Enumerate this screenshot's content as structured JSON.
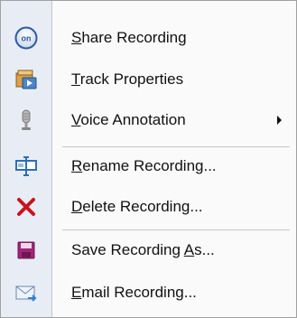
{
  "menu": {
    "items": [
      {
        "icon": "share-icon",
        "pre": "",
        "acc": "S",
        "post": "hare Recording"
      },
      {
        "icon": "track-properties-icon",
        "pre": "",
        "acc": "T",
        "post": "rack Properties"
      },
      {
        "icon": "microphone-icon",
        "pre": "",
        "acc": "V",
        "post": "oice Annotation",
        "submenu": true
      },
      {
        "icon": "rename-icon",
        "pre": "",
        "acc": "R",
        "post": "ename Recording..."
      },
      {
        "icon": "delete-icon",
        "pre": "",
        "acc": "D",
        "post": "elete Recording..."
      },
      {
        "icon": "save-icon",
        "pre": "Save Recording ",
        "acc": "A",
        "post": "s..."
      },
      {
        "icon": "email-icon",
        "pre": "",
        "acc": "E",
        "post": "mail Recording..."
      }
    ]
  }
}
